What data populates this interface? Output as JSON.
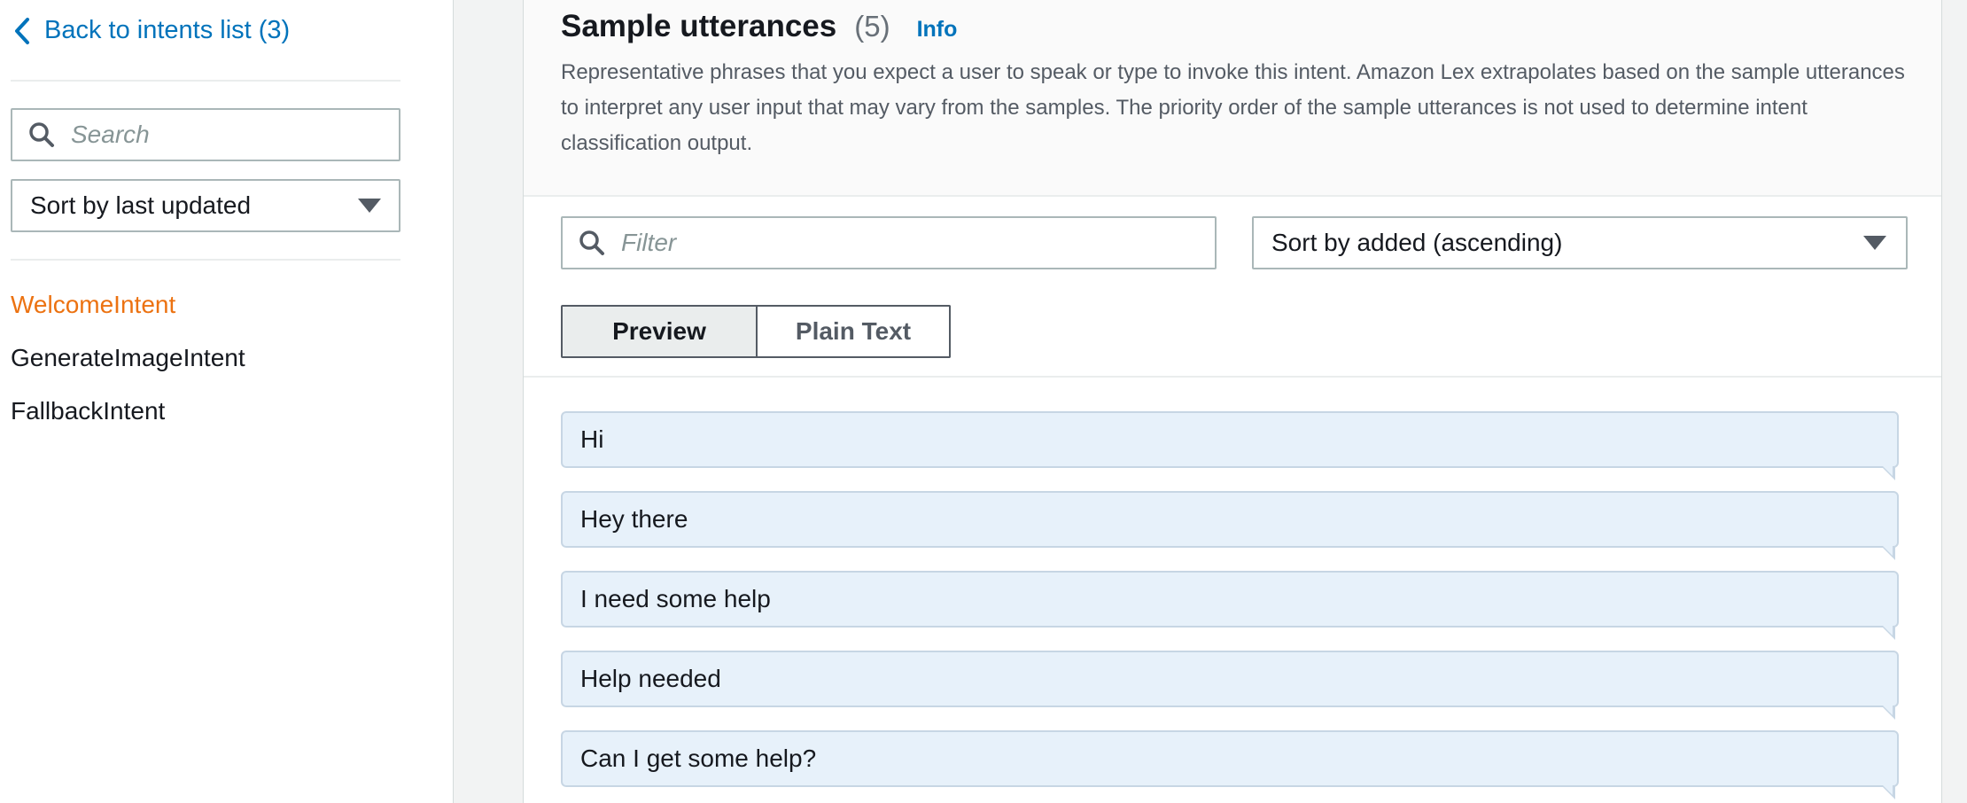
{
  "sidebar": {
    "back_link": "Back to intents list (3)",
    "search_placeholder": "Search",
    "sort_label": "Sort by last updated",
    "intents": [
      {
        "label": "WelcomeIntent",
        "active": true
      },
      {
        "label": "GenerateImageIntent",
        "active": false
      },
      {
        "label": "FallbackIntent",
        "active": false
      }
    ]
  },
  "utterances_panel": {
    "title": "Sample utterances",
    "count": "(5)",
    "info_label": "Info",
    "description": "Representative phrases that you expect a user to speak or type to invoke this intent. Amazon Lex extrapolates based on the sample utterances to interpret any user input that may vary from the samples. The priority order of the sample utterances is not used to determine intent classification output.",
    "filter_placeholder": "Filter",
    "sort_label": "Sort by added (ascending)",
    "view_modes": {
      "preview": "Preview",
      "plain_text": "Plain Text",
      "selected": "preview"
    },
    "items": [
      "Hi",
      "Hey there",
      "I need some help",
      "Help needed",
      "Can I get some help?"
    ]
  },
  "colors": {
    "link": "#0073bb",
    "active_intent": "#ec7211",
    "bubble_bg": "#e7f1fa"
  },
  "icons": [
    "chevron-left-icon",
    "search-icon",
    "caret-down-icon"
  ]
}
